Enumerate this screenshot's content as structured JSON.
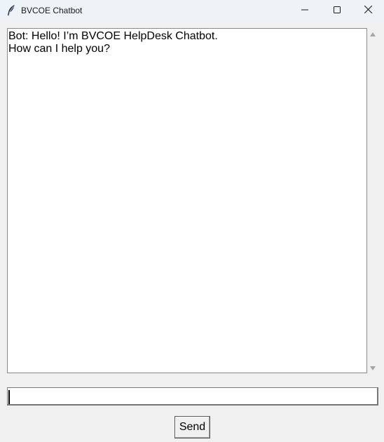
{
  "window": {
    "title": "BVCOE Chatbot",
    "icon": "feather-icon",
    "controls": [
      "minimize-icon",
      "maximize-icon",
      "close-icon"
    ]
  },
  "chat": {
    "lines": [
      "Bot: Hello! I’m BVCOE HelpDesk Chatbot.",
      "How can I help you?"
    ]
  },
  "entry": {
    "value": "",
    "placeholder": ""
  },
  "send_button": {
    "label": "Send"
  }
}
